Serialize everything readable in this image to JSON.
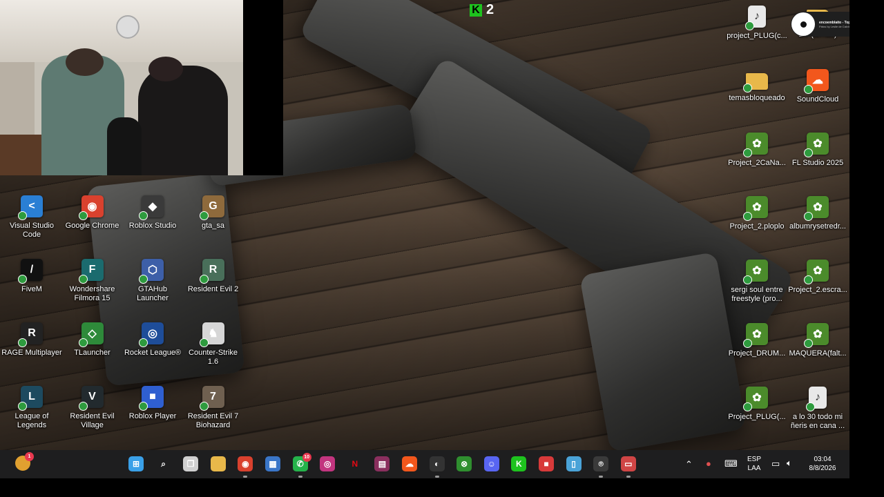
{
  "counter": {
    "icon": "k-icon",
    "value": "2"
  },
  "colors": {
    "taskbar": "#1e1e1f",
    "kick_green": "#1ec31e",
    "label_text": "#ffffff"
  },
  "now_playing": {
    "title": "encoemblaito - Topic",
    "subtitle": "Pátos by Leslie de Calvilo"
  },
  "desktop": {
    "left_icons": [
      {
        "label": "Visual Studio Code",
        "icon": "vscode-icon",
        "color": "#2a7fd4",
        "glyph": "<"
      },
      {
        "label": "Google Chrome",
        "icon": "chrome-icon",
        "color": "#d9412e",
        "glyph": "◉"
      },
      {
        "label": "Roblox Studio",
        "icon": "roblox-studio-icon",
        "color": "#3a3a3a",
        "glyph": "◆"
      },
      {
        "label": "gta_sa",
        "icon": "gta-icon",
        "color": "#8e6a3c",
        "glyph": "G"
      },
      {
        "label": "FiveM",
        "icon": "fivem-icon",
        "color": "#111111",
        "glyph": "/"
      },
      {
        "label": "Wondershare Filmora 15",
        "icon": "filmora-icon",
        "color": "#1b6b6e",
        "glyph": "F"
      },
      {
        "label": "GTAHub Launcher",
        "icon": "gtahub-icon",
        "color": "#3d5fa8",
        "glyph": "⬡"
      },
      {
        "label": "Resident Evil 2",
        "icon": "re2-icon",
        "color": "#496f5a",
        "glyph": "R"
      },
      {
        "label": "RAGE Multiplayer",
        "icon": "ragemp-icon",
        "color": "#222222",
        "glyph": "R"
      },
      {
        "label": "TLauncher",
        "icon": "tlauncher-icon",
        "color": "#2e8a3a",
        "glyph": "◇"
      },
      {
        "label": "Rocket League®",
        "icon": "rocket-league-icon",
        "color": "#1e4d99",
        "glyph": "◎"
      },
      {
        "label": "Counter-Strike 1.6",
        "icon": "counter-strike-icon",
        "color": "#d6d6d6",
        "glyph": "♞"
      },
      {
        "label": "League of Legends",
        "icon": "lol-icon",
        "color": "#1d4a5f",
        "glyph": "L"
      },
      {
        "label": "Resident Evil Village",
        "icon": "re-village-icon",
        "color": "#222a2e",
        "glyph": "V"
      },
      {
        "label": "Roblox Player",
        "icon": "roblox-icon",
        "color": "#2f5fd0",
        "glyph": "■"
      },
      {
        "label": "Resident Evil 7 Biohazard",
        "icon": "re7-icon",
        "color": "#6f6050",
        "glyph": "7"
      }
    ],
    "right_icons": [
      {
        "label": "project_PLUG(c...",
        "icon": "audio-file-icon",
        "color": "#e8e8e8",
        "glyph": "♪"
      },
      {
        "label": "E.P(temas)",
        "icon": "folder-icon",
        "color": "#e8b84a",
        "glyph": ""
      },
      {
        "label": "temasbloqueado",
        "icon": "folder-icon",
        "color": "#e8b84a",
        "glyph": ""
      },
      {
        "label": "SoundCloud",
        "icon": "soundcloud-icon",
        "color": "#f2571c",
        "glyph": "☁"
      },
      {
        "label": "Project_2CaNa...",
        "icon": "fl-project-icon",
        "color": "#4b8b2b",
        "glyph": "✿"
      },
      {
        "label": "FL Studio 2025",
        "icon": "fl-studio-icon",
        "color": "#4b8b2b",
        "glyph": "✿"
      },
      {
        "label": "Project_2.ploplo",
        "icon": "fl-project-icon",
        "color": "#4b8b2b",
        "glyph": "✿"
      },
      {
        "label": "albumrysetredr...",
        "icon": "fl-project-icon",
        "color": "#4b8b2b",
        "glyph": "✿"
      },
      {
        "label": "sergi soul entre freestyle (pro...",
        "icon": "fl-project-icon",
        "color": "#4b8b2b",
        "glyph": "✿"
      },
      {
        "label": "Project_2.escra...",
        "icon": "fl-project-icon",
        "color": "#4b8b2b",
        "glyph": "✿"
      },
      {
        "label": "Project_DRUM...",
        "icon": "fl-project-icon",
        "color": "#4b8b2b",
        "glyph": "✿"
      },
      {
        "label": "MAQUERA(falt...",
        "icon": "fl-project-icon",
        "color": "#4b8b2b",
        "glyph": "✿"
      },
      {
        "label": "Project_PLUG(...",
        "icon": "fl-project-icon",
        "color": "#4b8b2b",
        "glyph": "✿"
      },
      {
        "label": "a lo 30 todo mi ñeris en cana ...",
        "icon": "audio-file-icon",
        "color": "#e8e8e8",
        "glyph": "♪"
      }
    ]
  },
  "taskbar": {
    "weather_icon": "weather-icon",
    "weather_badge": "1",
    "apps": [
      {
        "name": "start-button",
        "icon": "windows-icon",
        "color": "#3aa0e8",
        "glyph": "⊞"
      },
      {
        "name": "search-button",
        "icon": "search-icon",
        "color": "transparent",
        "glyph": "⌕"
      },
      {
        "name": "task-view-button",
        "icon": "task-view-icon",
        "color": "#d0d0d0",
        "glyph": "❐"
      },
      {
        "name": "file-explorer-button",
        "icon": "folder-icon",
        "color": "#e8b84a",
        "glyph": ""
      },
      {
        "name": "chrome-button",
        "icon": "chrome-icon",
        "color": "#d9412e",
        "glyph": "◉"
      },
      {
        "name": "store-button",
        "icon": "store-icon",
        "color": "#3a76c8",
        "glyph": "▦"
      },
      {
        "name": "whatsapp-button",
        "icon": "whatsapp-icon",
        "color": "#25b34b",
        "glyph": "✆",
        "badge": "10"
      },
      {
        "name": "instagram-button",
        "icon": "instagram-icon",
        "color": "#c2357f",
        "glyph": "◎"
      },
      {
        "name": "netflix-button",
        "icon": "netflix-icon",
        "color": "transparent",
        "glyph": "N"
      },
      {
        "name": "winrar-button",
        "icon": "winrar-icon",
        "color": "#8a2f5e",
        "glyph": "▤"
      },
      {
        "name": "soundcloud-button",
        "icon": "soundcloud-icon",
        "color": "#f2571c",
        "glyph": "☁"
      },
      {
        "name": "obs-button",
        "icon": "obs-icon",
        "color": "#333333",
        "glyph": "◐"
      },
      {
        "name": "xbox-button",
        "icon": "xbox-icon",
        "color": "#2f8f2f",
        "glyph": "⊗"
      },
      {
        "name": "discord-button",
        "icon": "discord-icon",
        "color": "#5865f2",
        "glyph": "☺"
      },
      {
        "name": "kick-button",
        "icon": "kick-icon",
        "color": "#1ec31e",
        "glyph": "K"
      },
      {
        "name": "roblox-button",
        "icon": "roblox-icon",
        "color": "#d83a3a",
        "glyph": "■"
      },
      {
        "name": "notes-button",
        "icon": "notes-icon",
        "color": "#4aa3d8",
        "glyph": "▯"
      },
      {
        "name": "maps-button",
        "icon": "location-icon",
        "color": "#3a3a3a",
        "glyph": "⌾"
      },
      {
        "name": "gallery-button",
        "icon": "gallery-icon",
        "color": "#d04545",
        "glyph": "▭"
      }
    ],
    "tray": {
      "chevron_icon": "chevron-up-icon",
      "mic_icon": "microphone-icon",
      "keyboard_icon": "keyboard-icon",
      "language_line1": "ESP",
      "language_line2": "LAA",
      "network_icon": "network-icon",
      "volume_icon": "volume-icon",
      "time": "03:04",
      "date": "8/8/2026"
    }
  }
}
